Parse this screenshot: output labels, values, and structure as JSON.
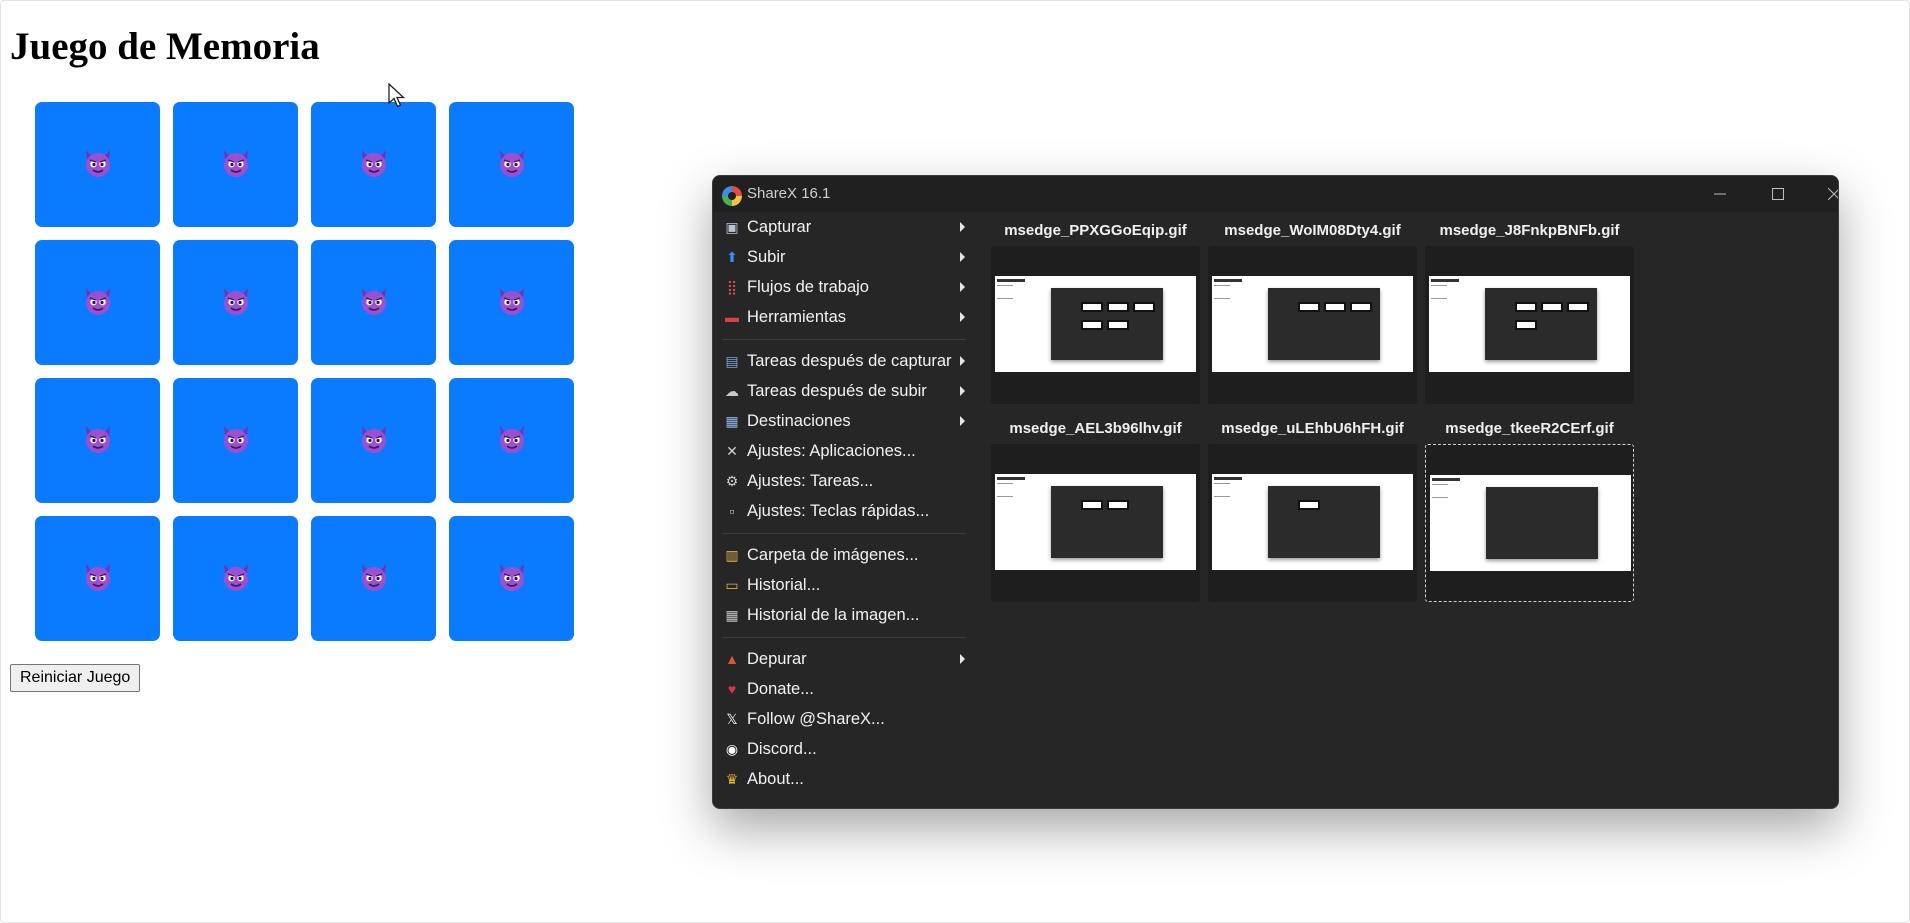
{
  "page": {
    "title": "Juego de Memoria"
  },
  "game": {
    "card_face": "smiling-imp-emoji",
    "card_count": 16,
    "card_color": "#0a7bff",
    "reset_label": "Reiniciar Juego"
  },
  "sharex": {
    "title": "ShareX 16.1",
    "menu": [
      {
        "label": "Capturar",
        "icon": "capture-icon",
        "submenu": true
      },
      {
        "label": "Subir",
        "icon": "upload-icon",
        "submenu": true
      },
      {
        "label": "Flujos de trabajo",
        "icon": "workflows-icon",
        "submenu": true
      },
      {
        "label": "Herramientas",
        "icon": "tools-icon",
        "submenu": true
      },
      {
        "label": "Tareas después de capturar",
        "icon": "after-capture-icon",
        "submenu": true
      },
      {
        "label": "Tareas después de subir",
        "icon": "after-upload-icon",
        "submenu": true
      },
      {
        "label": "Destinaciones",
        "icon": "destinations-icon",
        "submenu": true
      },
      {
        "label": "Ajustes: Aplicaciones...",
        "icon": "app-settings-icon",
        "submenu": false
      },
      {
        "label": "Ajustes: Tareas...",
        "icon": "task-settings-icon",
        "submenu": false
      },
      {
        "label": "Ajustes: Teclas rápidas...",
        "icon": "hotkey-settings-icon",
        "submenu": false
      },
      {
        "label": "Carpeta de imágenes...",
        "icon": "folder-icon",
        "submenu": false
      },
      {
        "label": "Historial...",
        "icon": "history-icon",
        "submenu": false
      },
      {
        "label": "Historial de la imagen...",
        "icon": "image-history-icon",
        "submenu": false
      },
      {
        "label": "Depurar",
        "icon": "debug-icon",
        "submenu": true
      },
      {
        "label": "Donate...",
        "icon": "heart-icon",
        "submenu": false
      },
      {
        "label": "Follow @ShareX...",
        "icon": "x-logo-icon",
        "submenu": false
      },
      {
        "label": "Discord...",
        "icon": "discord-icon",
        "submenu": false
      },
      {
        "label": "About...",
        "icon": "crown-icon",
        "submenu": false
      }
    ],
    "thumbnails": [
      {
        "name": "msedge_PPXGGoEqip.gif"
      },
      {
        "name": "msedge_WoIM08Dty4.gif"
      },
      {
        "name": "msedge_J8FnkpBNFb.gif"
      },
      {
        "name": "msedge_AEL3b96lhv.gif"
      },
      {
        "name": "msedge_uLEhbU6hFH.gif"
      },
      {
        "name": "msedge_tkeeR2CErf.gif",
        "selected": true
      }
    ]
  }
}
